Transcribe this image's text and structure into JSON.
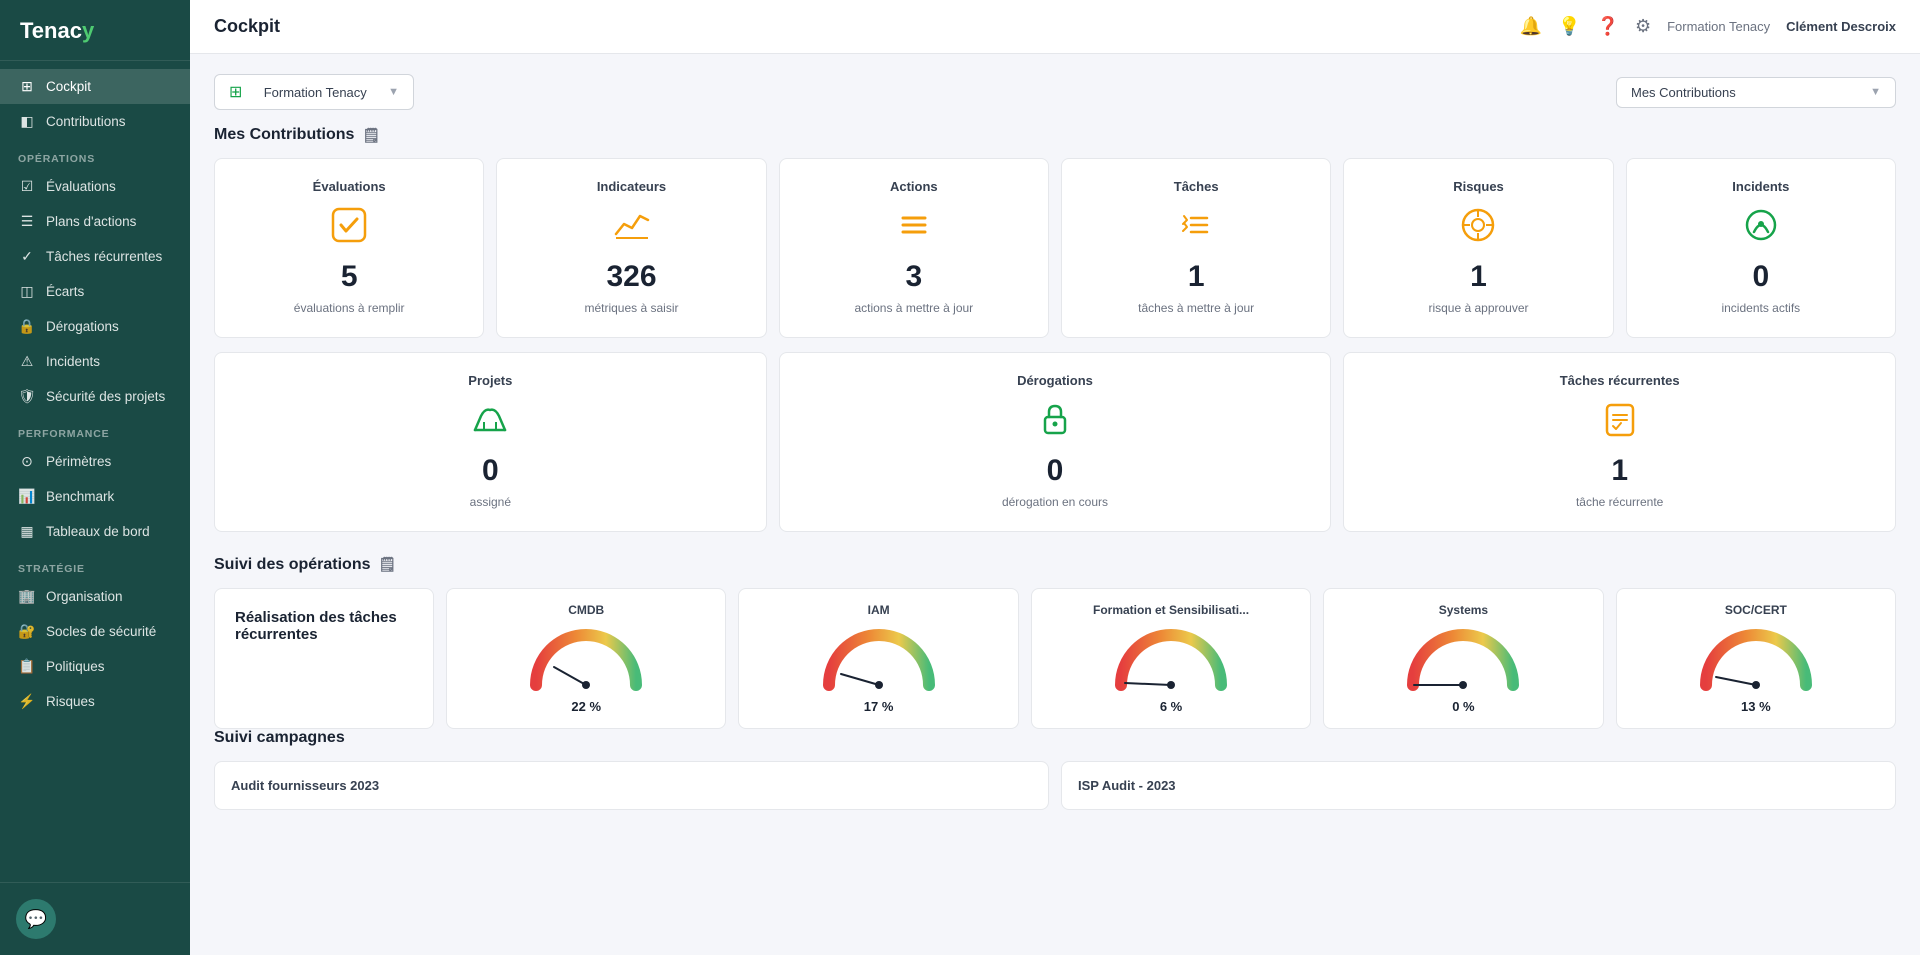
{
  "app": {
    "name": "Tenac",
    "dot": "y"
  },
  "topbar": {
    "title": "Cockpit",
    "org": "Formation Tenacy",
    "user": "Clément Descroix"
  },
  "sidebar": {
    "sections": [
      {
        "items": [
          {
            "id": "cockpit",
            "label": "Cockpit",
            "icon": "⊞",
            "active": true
          },
          {
            "id": "contributions",
            "label": "Contributions",
            "icon": "◧"
          }
        ]
      },
      {
        "label": "OPÉRATIONS",
        "items": [
          {
            "id": "evaluations",
            "label": "Évaluations",
            "icon": "☑"
          },
          {
            "id": "plans",
            "label": "Plans d'actions",
            "icon": "☰"
          },
          {
            "id": "taches",
            "label": "Tâches récurrentes",
            "icon": "✓"
          },
          {
            "id": "ecarts",
            "label": "Écarts",
            "icon": "◫"
          },
          {
            "id": "derogations",
            "label": "Dérogations",
            "icon": "🔒"
          },
          {
            "id": "incidents",
            "label": "Incidents",
            "icon": "⚠"
          },
          {
            "id": "securite",
            "label": "Sécurité des projets",
            "icon": "🛡"
          }
        ]
      },
      {
        "label": "PERFORMANCE",
        "items": [
          {
            "id": "perimetres",
            "label": "Périmètres",
            "icon": "⊙"
          },
          {
            "id": "benchmark",
            "label": "Benchmark",
            "icon": "📊"
          },
          {
            "id": "tableaux",
            "label": "Tableaux de bord",
            "icon": "▦"
          }
        ]
      },
      {
        "label": "STRATÉGIE",
        "items": [
          {
            "id": "organisation",
            "label": "Organisation",
            "icon": "🏢"
          },
          {
            "id": "socles",
            "label": "Socles de sécurité",
            "icon": "🔐"
          },
          {
            "id": "politiques",
            "label": "Politiques",
            "icon": "📋"
          },
          {
            "id": "risques",
            "label": "Risques",
            "icon": "⚡"
          }
        ]
      }
    ]
  },
  "filters": {
    "org_label": "Formation Tenacy",
    "view_label": "Mes Contributions"
  },
  "mes_contributions": {
    "title": "Mes Contributions",
    "stats_row1": [
      {
        "id": "evaluations",
        "title": "Évaluations",
        "number": "5",
        "desc": "évaluations à remplir",
        "icon": "✅",
        "icon_class": "icon-yellow"
      },
      {
        "id": "indicateurs",
        "title": "Indicateurs",
        "number": "326",
        "desc": "métriques à saisir",
        "icon": "📈",
        "icon_class": "icon-yellow"
      },
      {
        "id": "actions",
        "title": "Actions",
        "number": "3",
        "desc": "actions à mettre à jour",
        "icon": "≡",
        "icon_class": "icon-yellow"
      },
      {
        "id": "taches",
        "title": "Tâches",
        "number": "1",
        "desc": "tâches à mettre à jour",
        "icon": "☑",
        "icon_class": "icon-yellow"
      },
      {
        "id": "risques",
        "title": "Risques",
        "number": "1",
        "desc": "risque à approuver",
        "icon": "☢",
        "icon_class": "icon-yellow"
      },
      {
        "id": "incidents",
        "title": "Incidents",
        "number": "0",
        "desc": "incidents actifs",
        "icon": "🔥",
        "icon_class": "icon-green"
      }
    ],
    "stats_row2": [
      {
        "id": "projets",
        "title": "Projets",
        "number": "0",
        "desc": "assigné",
        "icon": "🏗",
        "icon_class": "icon-green"
      },
      {
        "id": "derogations",
        "title": "Dérogations",
        "number": "0",
        "desc": "dérogation en cours",
        "icon": "🔒",
        "icon_class": "icon-green"
      },
      {
        "id": "taches-rec",
        "title": "Tâches récurrentes",
        "number": "1",
        "desc": "tâche récurrente",
        "icon": "📋",
        "icon_class": "icon-yellow"
      }
    ]
  },
  "suivi_operations": {
    "title": "Suivi des opérations",
    "realisation_title": "Réalisation des tâches récurrentes",
    "gauges": [
      {
        "id": "cmdb",
        "title": "CMDB",
        "pct": 22,
        "pct_label": "22 %"
      },
      {
        "id": "iam",
        "title": "IAM",
        "pct": 17,
        "pct_label": "17 %"
      },
      {
        "id": "formation",
        "title": "Formation et Sensibilisati...",
        "pct": 6,
        "pct_label": "6 %"
      },
      {
        "id": "systems",
        "title": "Systems",
        "pct": 0,
        "pct_label": "0 %"
      },
      {
        "id": "soc",
        "title": "SOC/CERT",
        "pct": 13,
        "pct_label": "13 %"
      }
    ]
  },
  "suivi_campagnes": {
    "title": "Suivi campagnes",
    "items": [
      {
        "id": "audit-fournisseurs",
        "title": "Audit fournisseurs 2023"
      },
      {
        "id": "isp-audit",
        "title": "ISP Audit - 2023"
      }
    ]
  }
}
